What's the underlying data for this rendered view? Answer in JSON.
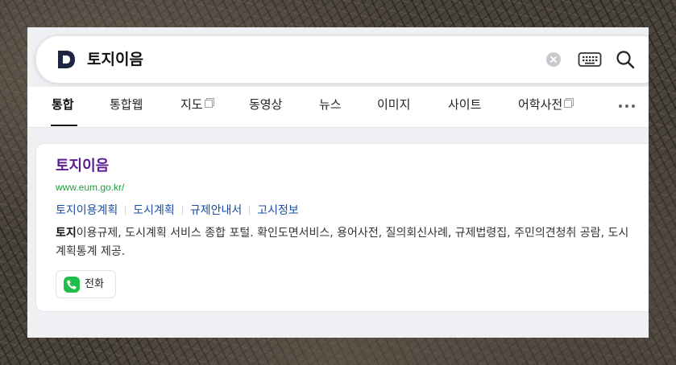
{
  "search": {
    "query": "토지이음",
    "logo_icon": "d-logo-icon",
    "clear_icon": "clear-icon",
    "keyboard_icon": "keyboard-icon",
    "search_icon": "search-icon"
  },
  "tabs": [
    {
      "label": "통합",
      "active": true
    },
    {
      "label": "통합웹"
    },
    {
      "label": "지도",
      "external": true
    },
    {
      "label": "동영상"
    },
    {
      "label": "뉴스"
    },
    {
      "label": "이미지"
    },
    {
      "label": "사이트"
    },
    {
      "label": "어학사전",
      "external": true
    }
  ],
  "more_icon": "more-icon",
  "result": {
    "title": "토지이음",
    "url": "www.eum.go.kr/",
    "sitelinks": [
      "토지이용계획",
      "도시계획",
      "규제안내서",
      "고시정보"
    ],
    "snippet_bold": "토지",
    "snippet_rest": "이용규제, 도시계획 서비스 종합 포털. 확인도면서비스, 용어사전, 질의회신사례, 규제법령집, 주민의견청취 공람, 도시계획통계 제공.",
    "phone_label": "전화",
    "phone_icon": "phone-icon"
  },
  "colors": {
    "title": "#5a1a91",
    "url": "#209d3f",
    "link": "#1a4fa3",
    "phone_green": "#1fbd4a",
    "logo_navy": "#1d2542"
  }
}
